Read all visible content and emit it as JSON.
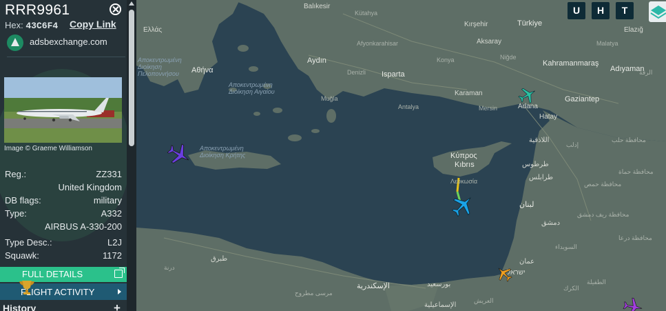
{
  "aircraft": {
    "callsign": "RRR9961",
    "hex_label": "Hex:",
    "hex": "43C6F4",
    "copy_link": "Copy Link",
    "source": "adsbexchange.com",
    "image_credit": "Image © Graeme Williamson",
    "fields": [
      {
        "label": "Reg.:",
        "value": "ZZ331"
      },
      {
        "label": "",
        "value": "United Kingdom"
      },
      {
        "label": "DB flags:",
        "value": "military"
      },
      {
        "label": "Type:",
        "value": "A332"
      },
      {
        "label": "",
        "value": "AIRBUS A-330-200"
      },
      {
        "label": "Type Desc.:",
        "value": "L2J"
      },
      {
        "label": "Squawk:",
        "value": "1172"
      }
    ]
  },
  "buttons": {
    "full_details": "FULL DETAILS",
    "flight_activity": "FLIGHT ACTIVITY",
    "history": "History",
    "history_add": "+"
  },
  "map_controls": {
    "u": "U",
    "h": "H",
    "t": "T"
  },
  "map_labels": {
    "balikesir": "Balıkesir",
    "kutahya": "Kütahya",
    "kirsehir": "Kırşehir",
    "turkiye": "Türkiye",
    "elazig": "Elazığ",
    "ellas": "Ελλάς",
    "afyon": "Afyonkarahisar",
    "aksaray": "Aksaray",
    "nigde": "Niğde",
    "malatya": "Malatya",
    "aydin": "Aydın",
    "konya": "Konya",
    "athina": "Αθήνα",
    "kahramanmaras": "Kahramanmaraş",
    "adiyaman": "Adıyaman",
    "denizli": "Denizli",
    "isparta": "Isparta",
    "karaman": "Karaman",
    "mugla": "Muğla",
    "antalya": "Antalya",
    "mersin": "Mersin",
    "adana": "Adana",
    "gaziantep": "Gaziantep",
    "hatay": "Hatay",
    "kypros": "Κύπρος",
    "kibris": "Kıbrıs",
    "lefkosa": "Λευκωσία",
    "latakia": "اللاذقية",
    "tartus": "طرطوس",
    "tripoli": "طرابلس",
    "lubnan": "لبنان",
    "dimashq": "دمشق",
    "oman": "عمان",
    "israel": "ישראל",
    "alexandria": "الإسكندرية",
    "port_said": "بورسعيد",
    "ismailia": "الإسماعيلية",
    "tobruk": "طبرق",
    "derna": "درنة",
    "arish": "العريش",
    "marsa_matruh": "مرسى مطروح",
    "aegean_decentralized": "Αποκεντρωμένη Διοίκηση Αιγαίου",
    "crete_decentralized": "Αποκεντρωμένη Διοίκηση Κρήτης",
    "peloponnese": "Αποκεντρωμένη Διοίκηση Πελοποννήσου",
    "aleppo_gov": "محافظة حلب",
    "hama_gov": "محافظة حماة",
    "homs_gov": "محافظة حمص",
    "idlib": "إدلب",
    "raqqa": "الرقة",
    "suwayda": "السويداء",
    "karak": "الكرك",
    "tafila": "الطفيلة",
    "daraa": "محافظة درعا",
    "rif_dimashq": "محافظة ريف دمشق"
  },
  "colors": {
    "sidebar_bg": "#263238",
    "full_details_bg": "#2bc18b",
    "flight_activity_bg": "#1f5a73",
    "sea": "#2b4352",
    "land": "#5e6e66",
    "selected_aircraft": "#1aa3e8"
  }
}
